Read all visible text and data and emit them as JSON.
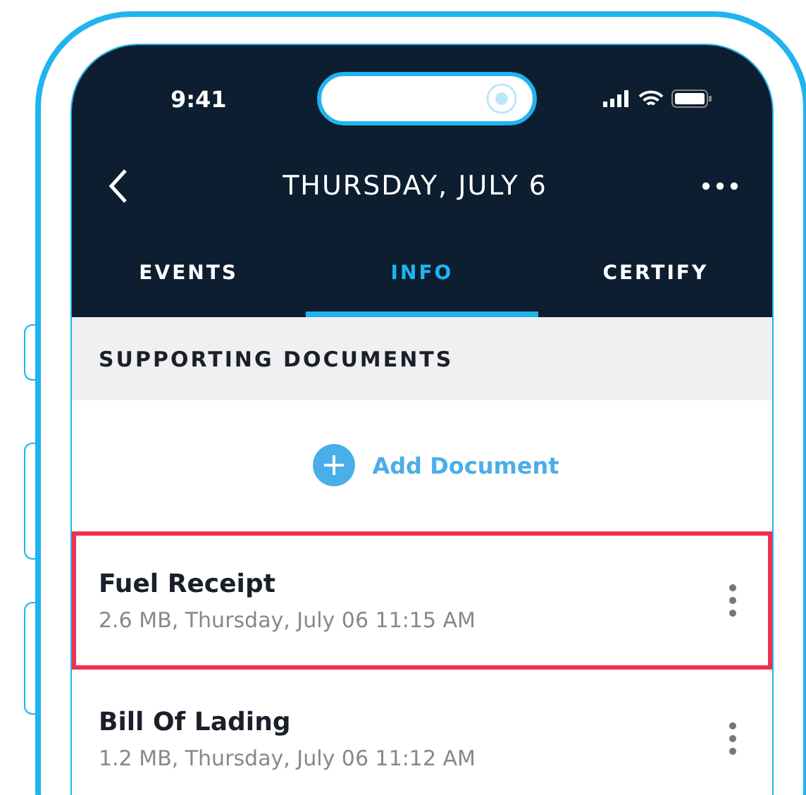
{
  "status_bar": {
    "time": "9:41"
  },
  "header": {
    "title": "THURSDAY, JULY 6"
  },
  "tabs": [
    {
      "label": "EVENTS",
      "selected": false
    },
    {
      "label": "INFO",
      "selected": true
    },
    {
      "label": "CERTIFY",
      "selected": false
    }
  ],
  "section": {
    "title": "SUPPORTING DOCUMENTS"
  },
  "add_button": {
    "label": "Add Document"
  },
  "documents": [
    {
      "name": "Fuel Receipt",
      "details": "2.6 MB, Thursday, July 06 11:15 AM",
      "highlighted": true
    },
    {
      "name": "Bill Of Lading",
      "details": "1.2 MB, Thursday, July 06 11:12 AM",
      "highlighted": false
    }
  ]
}
